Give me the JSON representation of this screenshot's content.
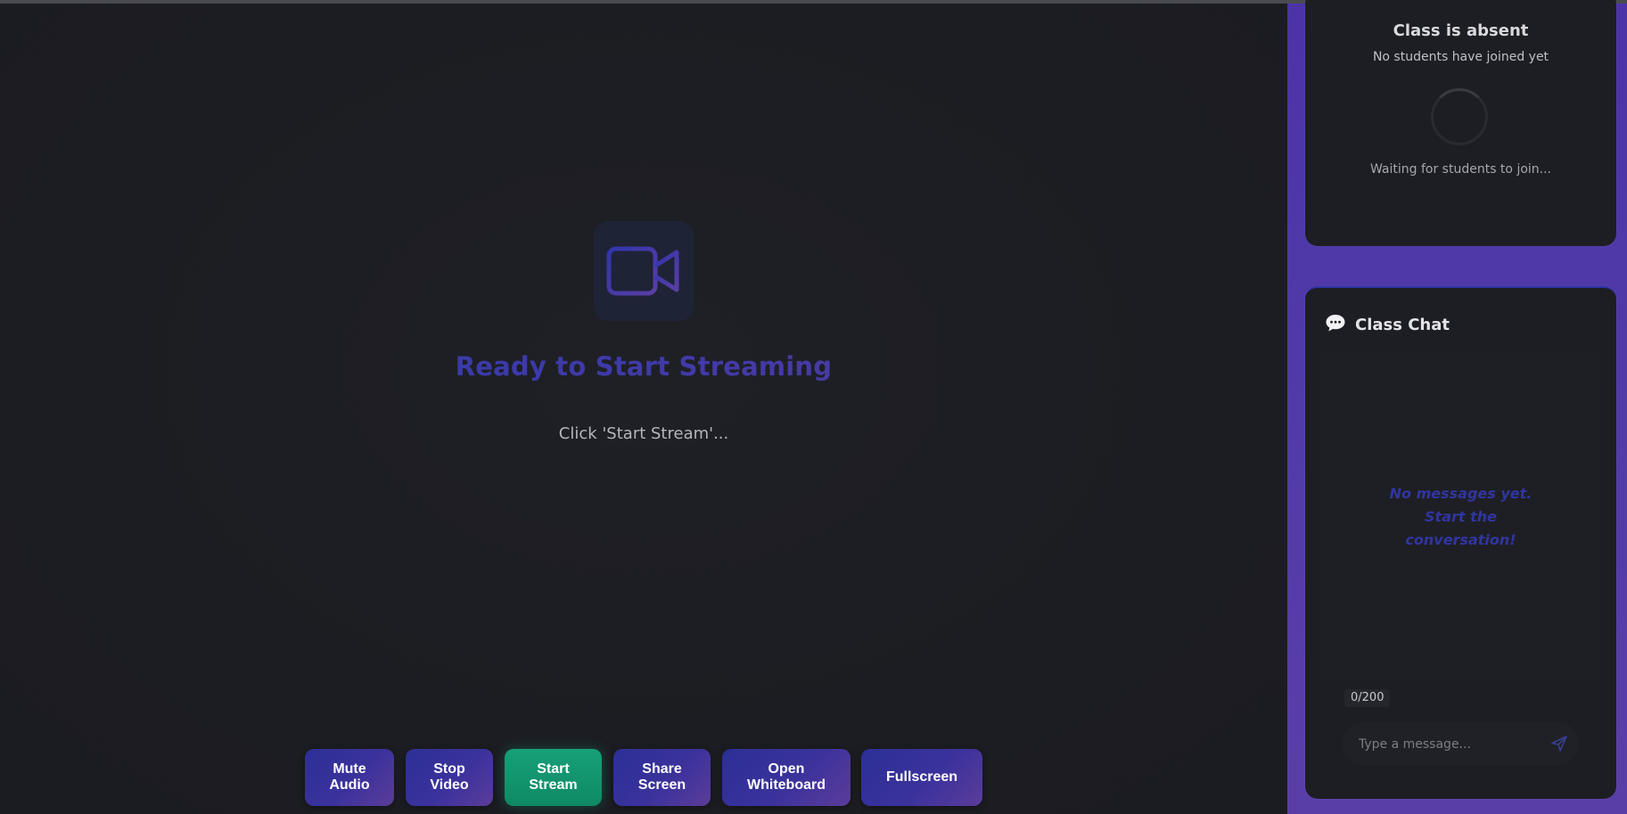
{
  "stage": {
    "title": "Ready to Start Streaming",
    "subtitle": "Click 'Start Stream'..."
  },
  "controls": [
    {
      "label": "Mute\nAudio",
      "name": "mute-audio-button"
    },
    {
      "label": "Stop\nVideo",
      "name": "stop-video-button"
    },
    {
      "label": "Start\nStream",
      "name": "start-stream-button"
    },
    {
      "label": "Share\nScreen",
      "name": "share-screen-button"
    },
    {
      "label": "Open\nWhiteboard",
      "name": "open-whiteboard-button"
    },
    {
      "label": "Fullscreen",
      "name": "fullscreen-button"
    }
  ],
  "students": {
    "title": "Class is absent",
    "subtitle": "No students have joined yet",
    "waiting": "Waiting for students to join..."
  },
  "chat": {
    "title": "Class Chat",
    "icon": "speech-bubble-icon",
    "empty_message": "No messages yet. Start the conversation!",
    "counter": "0/200",
    "input_placeholder": "Type a message...",
    "input_value": ""
  },
  "colors": {
    "accent_primary": "#2c2f96",
    "accent_secondary": "#5b3c9a",
    "start_stream": "#12996f",
    "sidebar": "#4c33a8"
  }
}
